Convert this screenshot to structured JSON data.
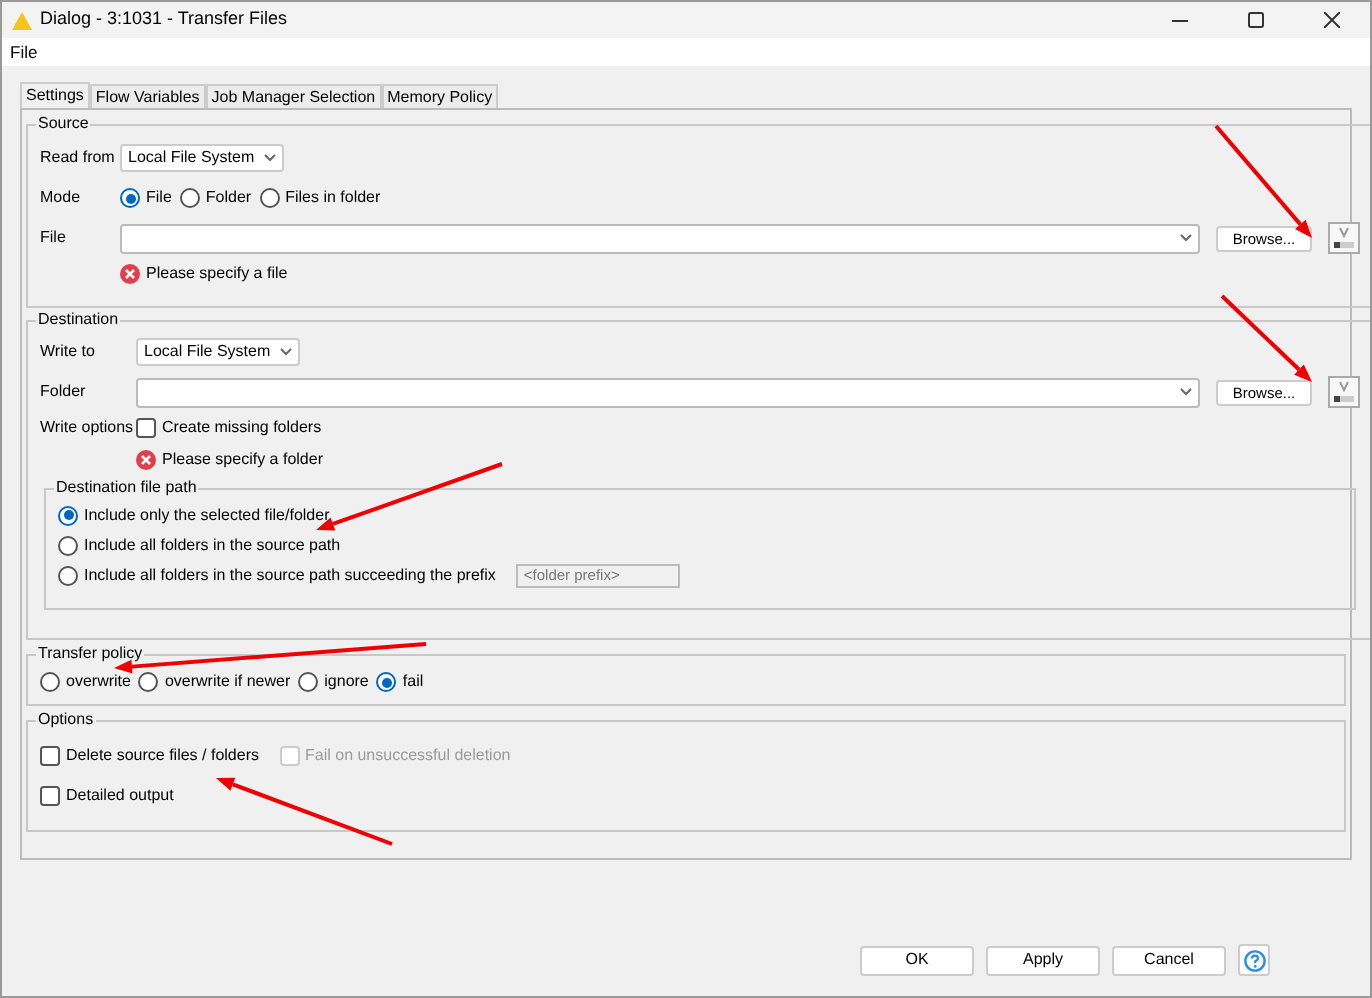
{
  "window": {
    "title": "Dialog - 3:1031 - Transfer Files"
  },
  "menu": [
    "File"
  ],
  "tabs": [
    {
      "label": "Settings",
      "selected": true
    },
    {
      "label": "Flow Variables",
      "selected": false
    },
    {
      "label": "Job Manager Selection",
      "selected": false
    },
    {
      "label": "Memory Policy",
      "selected": false
    }
  ],
  "source": {
    "title": "Source",
    "read_from": {
      "label": "Read from",
      "value": "Local File System"
    },
    "mode": {
      "label": "Mode",
      "options": [
        {
          "label": "File",
          "selected": true
        },
        {
          "label": "Folder",
          "selected": false
        },
        {
          "label": "Files in folder",
          "selected": false
        }
      ]
    },
    "file": {
      "label": "File",
      "browse": "Browse..."
    },
    "error": "Please specify a file"
  },
  "destination": {
    "title": "Destination",
    "write_to": {
      "label": "Write to",
      "value": "Local File System"
    },
    "folder": {
      "label": "Folder",
      "browse": "Browse..."
    },
    "write_options": {
      "label": "Write options",
      "checkbox": {
        "label": "Create missing folders",
        "checked": false
      }
    },
    "error": "Please specify a folder",
    "file_path": {
      "title": "Destination file path",
      "options": [
        {
          "label": "Include only the selected file/folder",
          "selected": true
        },
        {
          "label": "Include all folders in the source path",
          "selected": false
        },
        {
          "label": "Include all folders in the source path succeeding the prefix",
          "selected": false
        }
      ],
      "prefix_placeholder": "<folder prefix>"
    }
  },
  "transfer_policy": {
    "title": "Transfer policy",
    "options": [
      {
        "label": "overwrite",
        "selected": false
      },
      {
        "label": "overwrite if newer",
        "selected": false
      },
      {
        "label": "ignore",
        "selected": false
      },
      {
        "label": "fail",
        "selected": true
      }
    ]
  },
  "options": {
    "title": "Options",
    "items": [
      {
        "label": "Delete source files / folders",
        "checked": false,
        "disabled": false
      },
      {
        "label": "Fail on unsuccessful deletion",
        "checked": false,
        "disabled": true
      },
      {
        "label": "Detailed output",
        "checked": false,
        "disabled": false
      }
    ]
  },
  "buttons": [
    "OK",
    "Apply",
    "Cancel"
  ]
}
